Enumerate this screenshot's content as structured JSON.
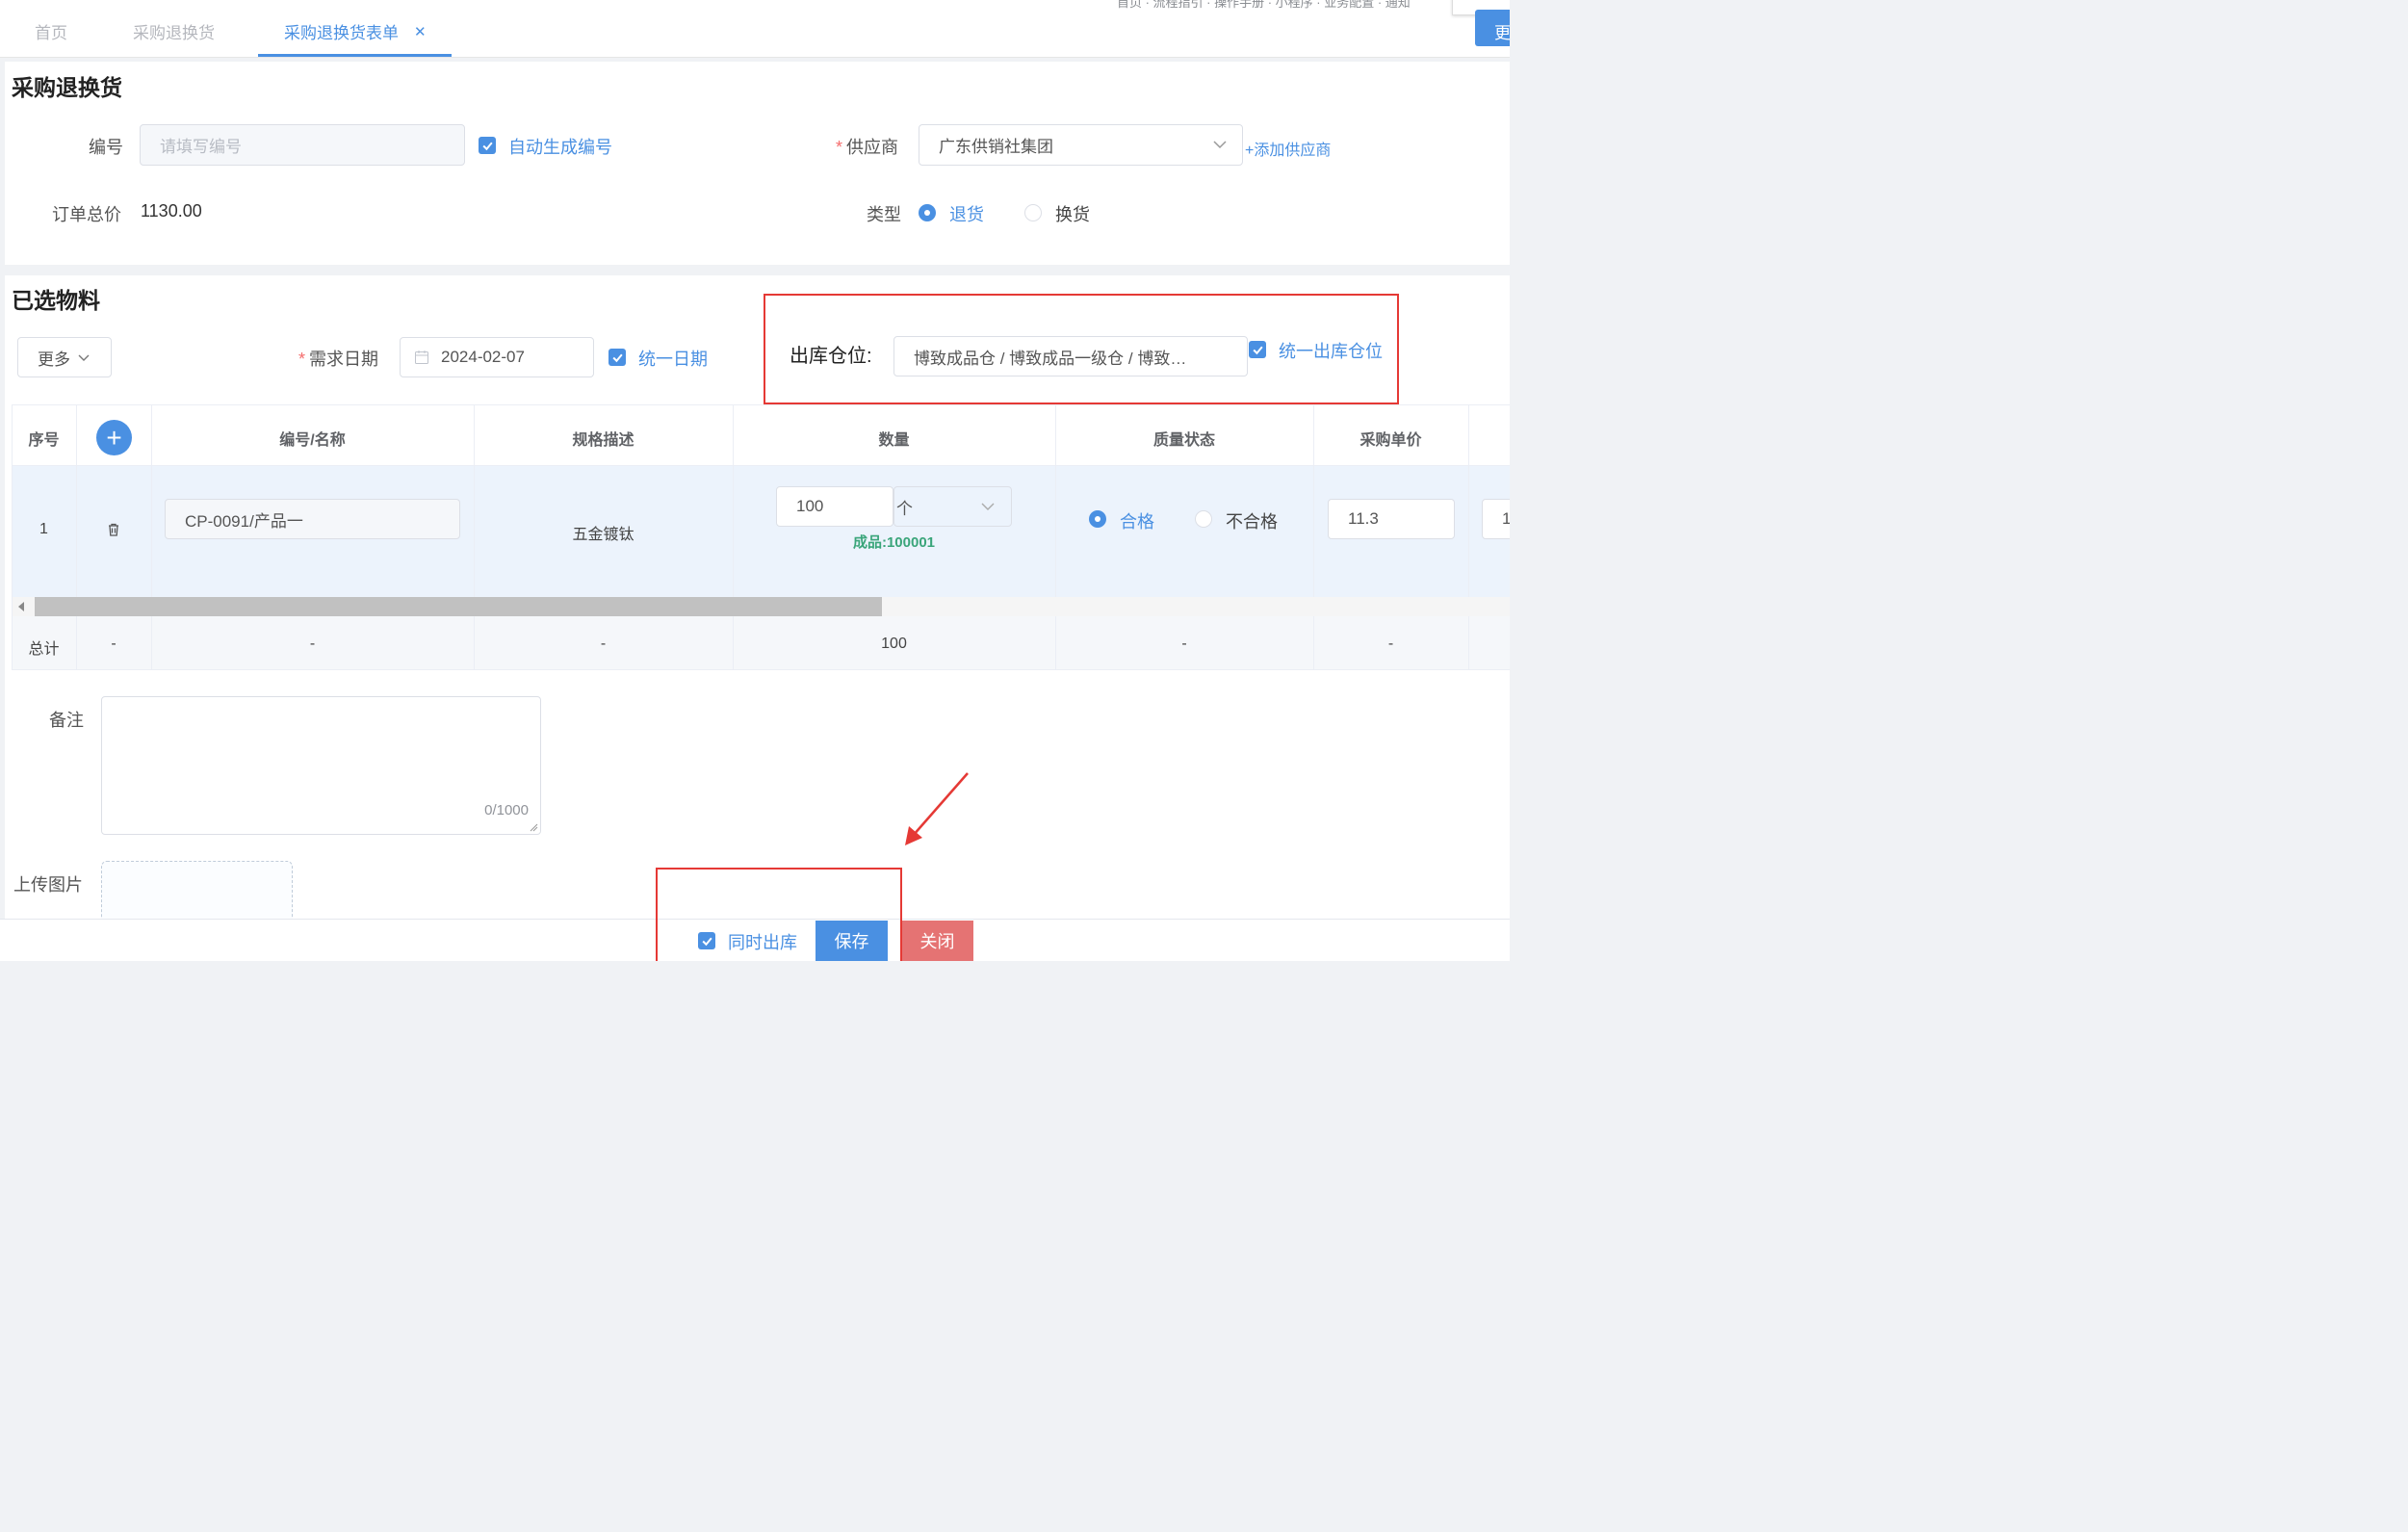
{
  "tabs": [
    {
      "label": "首页",
      "active": false
    },
    {
      "label": "采购退换货",
      "active": false
    },
    {
      "label": "采购退换货表单",
      "active": true
    }
  ],
  "topright": {
    "menu_text": "首页 · 流程指引 · 操作手册 · 小程序 · 业务配置 · 通知",
    "btn_label": "更"
  },
  "form": {
    "section_title": "采购退换货",
    "code_label": "编号",
    "code_placeholder": "请填写编号",
    "auto_code_label": "自动生成编号",
    "supplier_label": "供应商",
    "supplier_value": "广东供销社集团",
    "add_supplier_link": "+添加供应商",
    "total_label": "订单总价",
    "total_value": "1130.00",
    "type_label": "类型",
    "type_options": [
      "退货",
      "换货"
    ],
    "type_selected": "退货"
  },
  "materials": {
    "section_title": "已选物料",
    "more_label": "更多",
    "demand_date_label": "需求日期",
    "demand_date_value": "2024-02-07",
    "unify_date_label": "统一日期",
    "warehouse_label": "出库仓位:",
    "warehouse_value": "博致成品仓 / 博致成品一级仓 / 博致…",
    "unify_warehouse_label": "统一出库仓位"
  },
  "table": {
    "columns": [
      "序号",
      "",
      "编号/名称",
      "规格描述",
      "数量",
      "质量状态",
      "采购单价"
    ],
    "rows": [
      {
        "index": "1",
        "code_name": "CP-0091/产品一",
        "spec": "五金镀钛",
        "qty": "100",
        "unit": "个",
        "stock_label": "成品:",
        "stock_value": "100001",
        "quality_options": [
          "合格",
          "不合格"
        ],
        "quality_selected": "合格",
        "unit_price": "11.3",
        "extra_cell": "1"
      }
    ],
    "footer": [
      "总计",
      "-",
      "-",
      "-",
      "100",
      "-",
      "-"
    ]
  },
  "remark": {
    "label": "备注",
    "counter": "0/1000"
  },
  "upload": {
    "label": "上传图片"
  },
  "actions": {
    "same_outbound_label": "同时出库",
    "save_label": "保存",
    "close_label": "关闭"
  },
  "colors": {
    "primary": "#4a90e2",
    "danger": "#e57373",
    "annotation": "#e53935",
    "success": "#3aa57a"
  }
}
